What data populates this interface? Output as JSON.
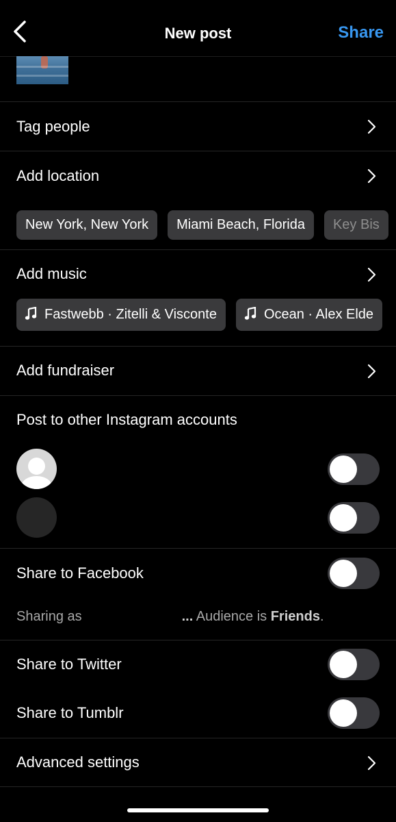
{
  "header": {
    "title": "New post",
    "share_label": "Share",
    "share_color": "#3897f0"
  },
  "rows": {
    "tag_people": "Tag people",
    "add_location": "Add location",
    "add_music": "Add music",
    "add_fundraiser": "Add fundraiser",
    "post_other_accounts": "Post to other Instagram accounts",
    "share_facebook": "Share to Facebook",
    "share_twitter": "Share to Twitter",
    "share_tumblr": "Share to Tumblr",
    "advanced_settings": "Advanced settings"
  },
  "location_suggestions": [
    "New York, New York",
    "Miami Beach, Florida",
    "Key Bis"
  ],
  "music_suggestions": [
    "Fastwebb · Zitelli & Visconte",
    "Ocean · Alex Elde"
  ],
  "facebook_note": {
    "prefix": "Sharing as",
    "ellipsis": "...",
    "audience_text": "Audience is",
    "audience_value": "Friends",
    "end": "."
  },
  "toggles": {
    "account_1": false,
    "account_2": false,
    "facebook": false,
    "twitter": false,
    "tumblr": false
  },
  "icons": {
    "back": "chevron-left-icon",
    "row_arrow": "chevron-right-icon",
    "music": "music-note-icon",
    "avatar_placeholder": "user-avatar-icon"
  }
}
